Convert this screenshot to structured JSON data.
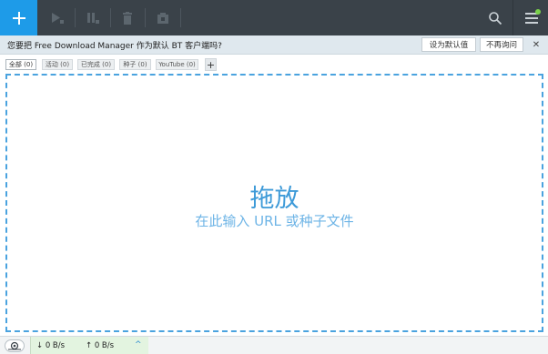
{
  "toolbar": {
    "add_icon": "plus-icon",
    "buttons": [
      {
        "name": "resume-icon"
      },
      {
        "name": "pause-icon"
      },
      {
        "name": "delete-icon"
      },
      {
        "name": "move-icon"
      }
    ],
    "search_icon": "search-icon",
    "menu_icon": "hamburger-menu-icon",
    "accent_color": "#1e9be8",
    "bg_color": "#3a4249",
    "notification_color": "#7ad24b"
  },
  "bt_prompt": {
    "text": "您要把 Free Download Manager 作为默认 BT 客户端吗?",
    "set_default_label": "设为默认值",
    "dont_ask_label": "不再询问",
    "close_label": "✕"
  },
  "tabs": [
    {
      "label": "全部 (0)",
      "active": true
    },
    {
      "label": "活动 (0)",
      "active": false
    },
    {
      "label": "已完成 (0)",
      "active": false
    },
    {
      "label": "种子 (0)",
      "active": false
    },
    {
      "label": "YouTube (0)",
      "active": false
    }
  ],
  "tab_add_label": "+",
  "dropzone": {
    "title": "拖放",
    "subtitle": "在此输入 URL 或种子文件",
    "border_color": "#4aa3df"
  },
  "status": {
    "download_speed": "↓ 0 B/s",
    "upload_speed": "↑ 0 B/s",
    "expand_label": "^"
  }
}
